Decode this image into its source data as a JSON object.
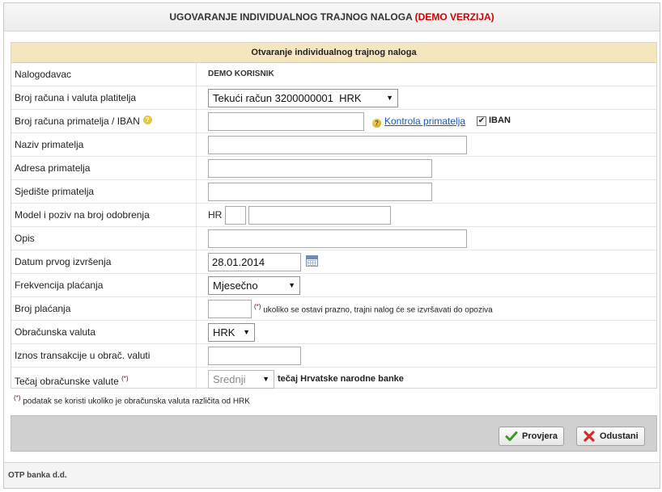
{
  "title": {
    "main": "UGOVARANJE INDIVIDUALNOG TRAJNOG NALOGA",
    "demo": "(DEMO VERZIJA)"
  },
  "form": {
    "header": "Otvaranje individualnog trajnog naloga",
    "nalogodavac": {
      "label": "Nalogodavac",
      "value": "DEMO KORISNIK"
    },
    "racun_platitelja": {
      "label": "Broj računa i valuta platitelja",
      "selected": "Tekući račun 3200000001  HRK"
    },
    "racun_primatelja": {
      "label": "Broj računa primatelja / IBAN",
      "help_icon": "?",
      "value": "",
      "kontrola_icon": "?",
      "kontrola_link": "Kontrola primatelja",
      "iban_checked": "✔",
      "iban_label": "IBAN"
    },
    "naziv": {
      "label": "Naziv primatelja",
      "value": ""
    },
    "adresa": {
      "label": "Adresa primatelja",
      "value": ""
    },
    "sjediste": {
      "label": "Sjedište primatelja",
      "value": ""
    },
    "model": {
      "label": "Model i poziv na broj odobrenja",
      "prefix": "HR",
      "model_value": "",
      "poziv_value": ""
    },
    "opis": {
      "label": "Opis",
      "value": ""
    },
    "datum": {
      "label": "Datum prvog izvršenja",
      "value": "28.01.2014"
    },
    "frekvencija": {
      "label": "Frekvencija plaćanja",
      "selected": "Mjesečno"
    },
    "broj_placanja": {
      "label": "Broj plaćanja",
      "value": "",
      "hint": "ukoliko se ostavi prazno, trajni nalog će se izvršavati do opoziva"
    },
    "obracunska_valuta": {
      "label": "Obračunska valuta",
      "selected": "HRK"
    },
    "iznos": {
      "label": "Iznos transakcije u obrač. valuti",
      "value": ""
    },
    "tecaj": {
      "label": "Tečaj obračunske valute",
      "selected": "Srednji",
      "note": "tečaj Hrvatske narodne banke"
    }
  },
  "marks": {
    "open": "(",
    "star": "*",
    "close": ")"
  },
  "arrow": "▼",
  "footnote": "podatak se koristi ukoliko je obračunska valuta različita od HRK",
  "buttons": {
    "provjera": "Provjera",
    "odustani": "Odustani"
  },
  "footer": "OTP banka d.d.",
  "colors": {
    "demo_red": "#d40000",
    "header_bg": "#f5e6bf",
    "link": "#1f56b3",
    "check_green": "#3a9d23",
    "cancel_red": "#d42b2b"
  }
}
